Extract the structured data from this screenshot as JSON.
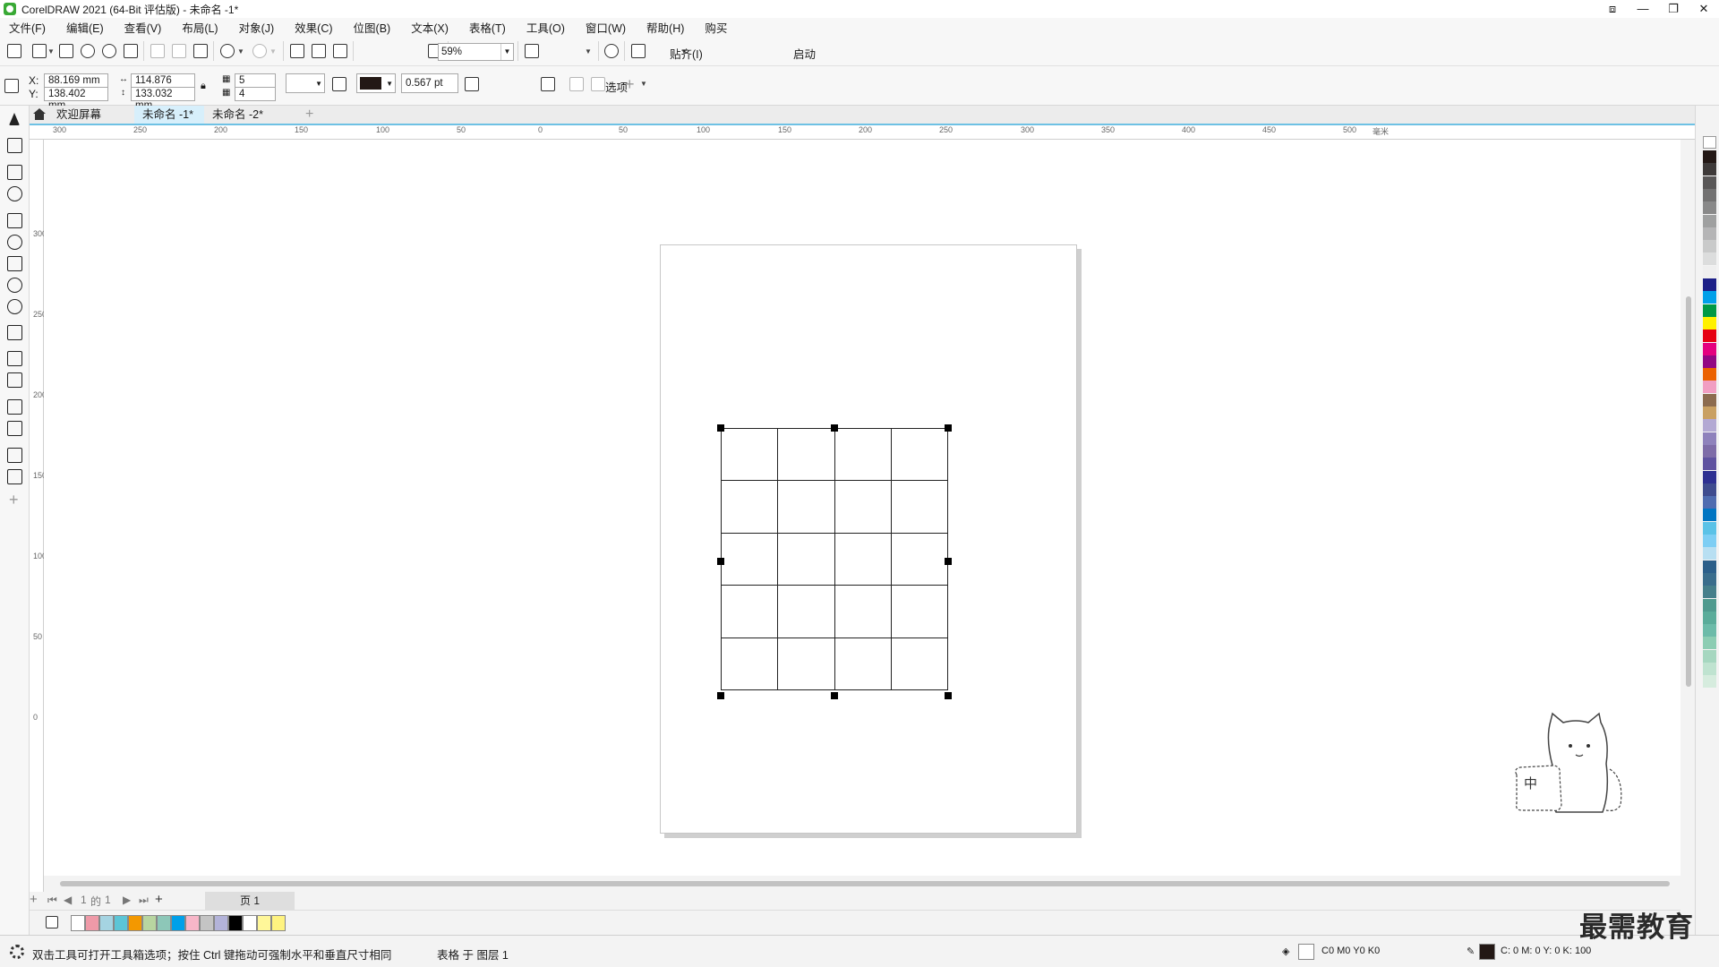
{
  "window": {
    "title": "CorelDRAW 2021 (64-Bit 评估版) - 未命名 -1*",
    "controls": [
      "⧈",
      "—",
      "❐",
      "✕"
    ]
  },
  "menu": [
    "文件(F)",
    "编辑(E)",
    "查看(V)",
    "布局(L)",
    "对象(J)",
    "效果(C)",
    "位图(B)",
    "文本(X)",
    "表格(T)",
    "工具(O)",
    "窗口(W)",
    "帮助(H)",
    "购买"
  ],
  "toolbar": {
    "zoom": "59%",
    "snap_label": "贴齐(I)",
    "start_label": "启动"
  },
  "properties": {
    "x_label": "X:",
    "y_label": "Y:",
    "x": "88.169 mm",
    "y": "138.402 mm",
    "width": "114.876 mm",
    "height": "133.032 mm",
    "rows": "5",
    "columns": "4",
    "outline_width": "0.567 pt",
    "options_label": "选项"
  },
  "tabs": [
    {
      "label": "欢迎屏幕",
      "active": false
    },
    {
      "label": "未命名 -1*",
      "active": true
    },
    {
      "label": "未命名 -2*",
      "active": false
    }
  ],
  "ruler": {
    "h_ticks": [
      "300",
      "250",
      "200",
      "150",
      "100",
      "50",
      "0",
      "50",
      "100",
      "150",
      "200",
      "250",
      "300",
      "350",
      "400",
      "450",
      "500"
    ],
    "unit": "毫米",
    "v_ticks": [
      "300",
      "250",
      "200",
      "150",
      "100",
      "50",
      "0"
    ]
  },
  "document_table": {
    "rows": 5,
    "columns": 4
  },
  "page_nav": {
    "position": "1",
    "of_label": "的",
    "total": "1",
    "page_tab": "页 1"
  },
  "status": {
    "hint": "双击工具可打开工具箱选项；按住 Ctrl 键拖动可强制水平和垂直尺寸相同",
    "object_info": "表格 于 图层 1",
    "fill_value": "C0 M0 Y0 K0",
    "outline_value": "C: 0 M: 0 Y: 0 K: 100"
  },
  "watermark": "最需教育",
  "ime": {
    "mode": "中"
  },
  "colors": {
    "accent": "#6ec1e4",
    "palette": [
      "#231815",
      "#3e3a39",
      "#595757",
      "#727171",
      "#898989",
      "#9fa0a0",
      "#b5b5b6",
      "#c9caca",
      "#dcdddd",
      "#efefef",
      "#1d2088",
      "#00a0e9",
      "#009944",
      "#fff100",
      "#e60012",
      "#e4007f",
      "#920783",
      "#eb6100",
      "#f19ec2",
      "#8c6b4f",
      "#c9a063",
      "#b3a9d3",
      "#8f82bc",
      "#7e6ca8",
      "#5f52a0",
      "#2e3092",
      "#3f4c8f",
      "#4f6cb0",
      "#0075c2",
      "#5bc2e7",
      "#7ecef4",
      "#b8dff2",
      "#2c5f8a",
      "#3a6d8c",
      "#467f8b",
      "#4f9a8e",
      "#5aac9a",
      "#6cbba9",
      "#8ccdb3",
      "#a6d7c0",
      "#bfe3d0",
      "#d6ecde"
    ],
    "doc_palette": [
      "#ef9aa8",
      "#a5d4e2",
      "#5cc5d6",
      "#f39800",
      "#b8d5a0",
      "#8dc7b8",
      "#00a0e9",
      "#f7b6c8",
      "#c4c4c4",
      "#b3b3d9",
      "#000000",
      "#ffffff",
      "#fff799",
      "#fff380"
    ]
  }
}
